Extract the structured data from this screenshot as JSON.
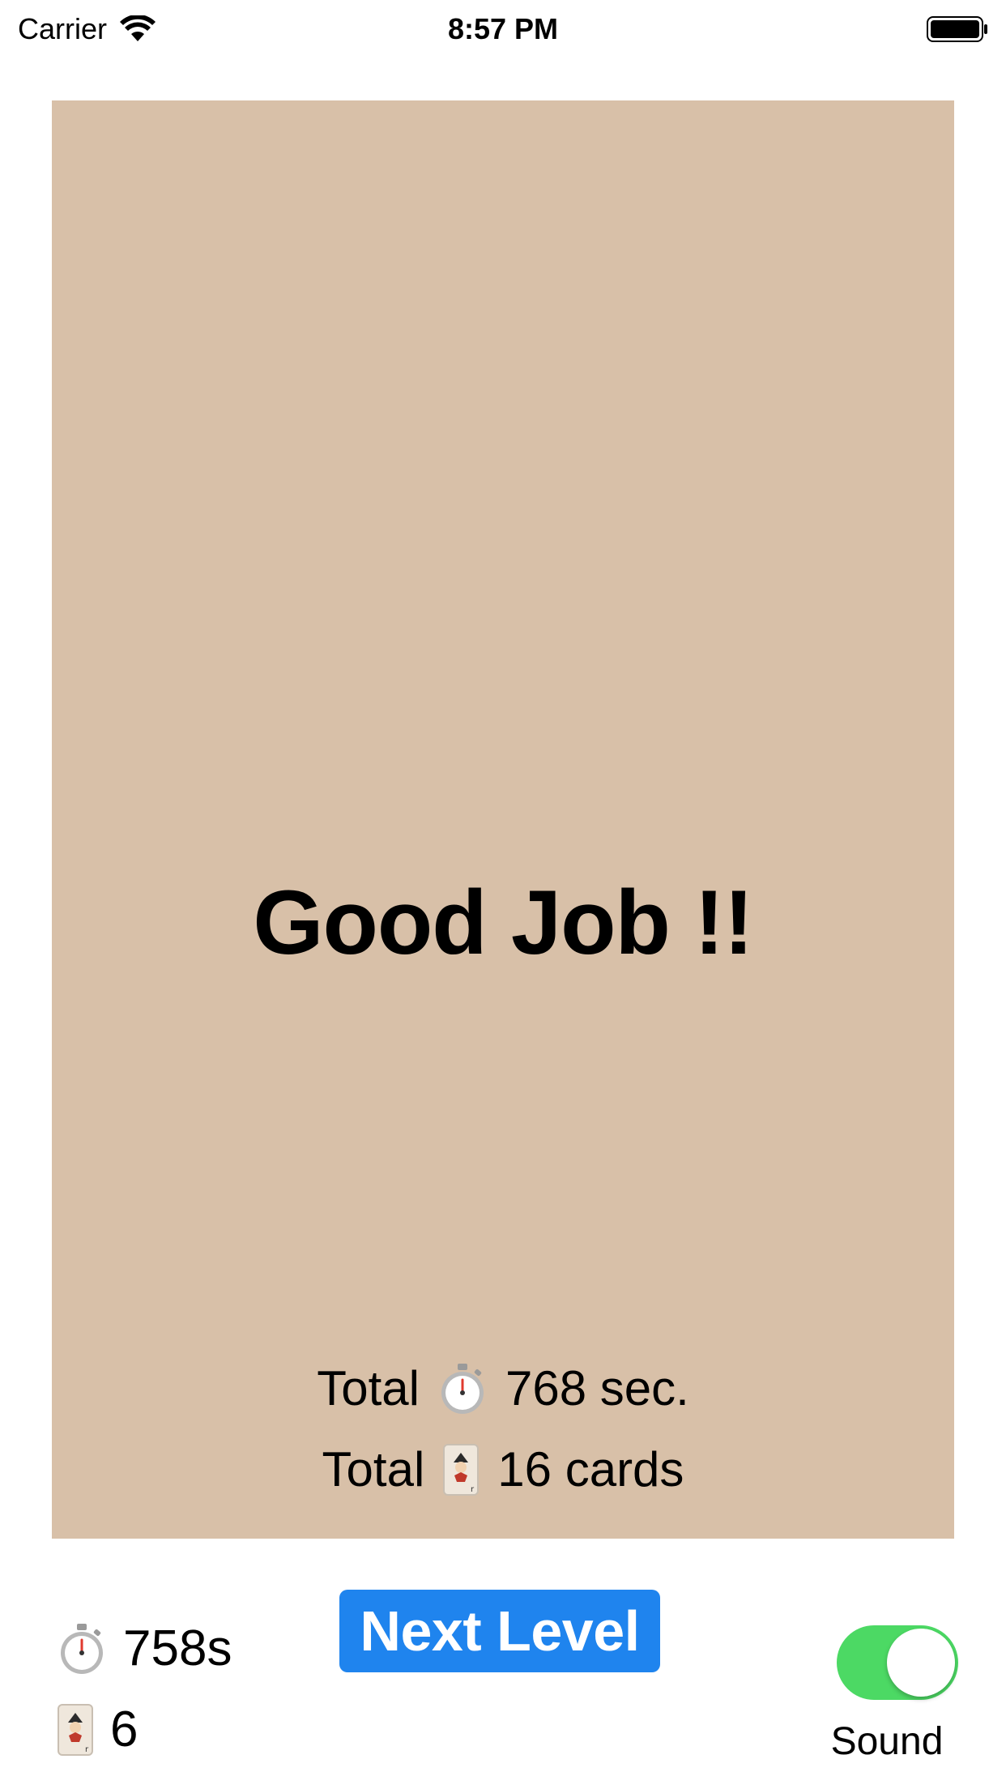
{
  "status_bar": {
    "carrier": "Carrier",
    "time": "8:57 PM"
  },
  "panel": {
    "title": "Good Job !!",
    "total_time_prefix": "Total",
    "total_time_value": "768 sec.",
    "total_cards_prefix": "Total",
    "total_cards_value": "16 cards"
  },
  "stats": {
    "time": "758s",
    "cards": "6"
  },
  "next_level_button": {
    "label": "Next Level"
  },
  "sound_toggle": {
    "label": "Sound",
    "on": true
  },
  "colors": {
    "panel_bg": "#d8c0a8",
    "button_bg": "#1f84ee",
    "toggle_on": "#4cd964"
  },
  "icons": {
    "stopwatch": "stopwatch-icon",
    "card": "joker-card-icon",
    "wifi": "wifi-icon",
    "battery": "battery-icon"
  }
}
